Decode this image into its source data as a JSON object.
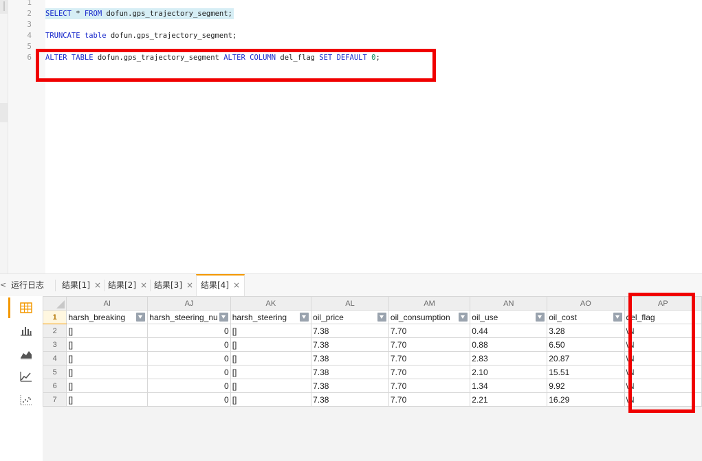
{
  "editor": {
    "lines": [
      {
        "no": "1"
      },
      {
        "no": "2",
        "text": "SELECT * FROM dofun.gps_trajectory_segment;"
      },
      {
        "no": "3"
      },
      {
        "no": "4",
        "text": "TRUNCATE table dofun.gps_trajectory_segment;"
      },
      {
        "no": "5"
      },
      {
        "no": "6",
        "text": "ALTER TABLE dofun.gps_trajectory_segment ALTER COLUMN del_flag SET DEFAULT 0;"
      }
    ],
    "line2": {
      "kw1": "SELECT",
      "op": " * ",
      "kw2": "FROM",
      "rest": " dofun.gps_trajectory_segment;"
    },
    "line4": {
      "kw1": "TRUNCATE",
      "kw2": "table",
      "rest": " dofun.gps_trajectory_segment;"
    },
    "line6": {
      "kw1": "ALTER TABLE",
      "obj": " dofun.gps_trajectory_segment ",
      "kw2": "ALTER COLUMN",
      "col": " del_flag ",
      "kw3": "SET DEFAULT",
      "val": "0",
      "end": ";"
    }
  },
  "tabs": {
    "scroll_glyph": "<",
    "log_label": "运行日志",
    "results": [
      {
        "label": "结果[1]",
        "close": "×"
      },
      {
        "label": "结果[2]",
        "close": "×"
      },
      {
        "label": "结果[3]",
        "close": "×"
      },
      {
        "label": "结果[4]",
        "close": "×",
        "active": true
      }
    ]
  },
  "side_tools": [
    "grid-view-icon",
    "bar-chart-icon",
    "area-chart-icon",
    "line-chart-icon",
    "scatter-chart-icon"
  ],
  "accent_color": "#f39800",
  "highlight_color": "#f00000",
  "grid": {
    "columns": [
      "AI",
      "AJ",
      "AK",
      "AL",
      "AM",
      "AN",
      "AO",
      "AP"
    ],
    "header_row_no": "1",
    "fields": [
      "harsh_breaking",
      "harsh_steering_nu",
      "harsh_steering",
      "oil_price",
      "oil_consumption",
      "oil_use",
      "oil_cost",
      "del_flag"
    ],
    "rows": [
      {
        "no": "2",
        "cells": [
          "[]",
          "0",
          "[]",
          "7.38",
          "7.70",
          "0.44",
          "3.28",
          "\\N"
        ]
      },
      {
        "no": "3",
        "cells": [
          "[]",
          "0",
          "[]",
          "7.38",
          "7.70",
          "0.88",
          "6.50",
          "\\N"
        ]
      },
      {
        "no": "4",
        "cells": [
          "[]",
          "0",
          "[]",
          "7.38",
          "7.70",
          "2.83",
          "20.87",
          "\\N"
        ]
      },
      {
        "no": "5",
        "cells": [
          "[]",
          "0",
          "[]",
          "7.38",
          "7.70",
          "2.10",
          "15.51",
          "\\N"
        ]
      },
      {
        "no": "6",
        "cells": [
          "[]",
          "0",
          "[]",
          "7.38",
          "7.70",
          "1.34",
          "9.92",
          "\\N"
        ]
      },
      {
        "no": "7",
        "cells": [
          "[]",
          "0",
          "[]",
          "7.38",
          "7.70",
          "2.21",
          "16.29",
          "\\N"
        ]
      }
    ]
  }
}
